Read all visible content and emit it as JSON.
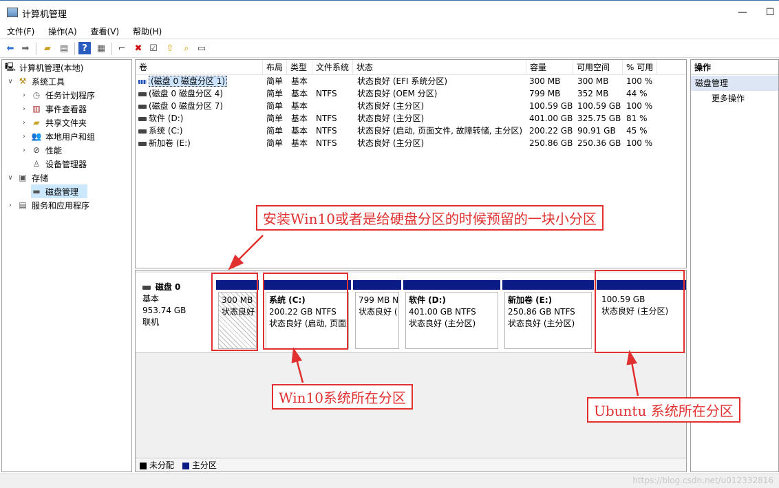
{
  "window": {
    "title": "计算机管理",
    "minimize": "—",
    "maximize": "☐"
  },
  "menu": [
    "文件(F)",
    "操作(A)",
    "查看(V)",
    "帮助(H)"
  ],
  "tree": {
    "root": "计算机管理(本地)",
    "system_tools": "系统工具",
    "task_scheduler": "任务计划程序",
    "event_viewer": "事件查看器",
    "shared_folders": "共享文件夹",
    "local_users": "本地用户和组",
    "performance": "性能",
    "device_manager": "设备管理器",
    "storage": "存储",
    "disk_management": "磁盘管理",
    "services": "服务和应用程序"
  },
  "volumes": {
    "headers": [
      "卷",
      "布局",
      "类型",
      "文件系统",
      "状态",
      "容量",
      "可用空间",
      "% 可用"
    ],
    "rows": [
      {
        "name": "(磁盘 0 磁盘分区 1)",
        "layout": "简单",
        "type": "基本",
        "fs": "",
        "status": "状态良好 (EFI 系统分区)",
        "capacity": "300 MB",
        "free": "300 MB",
        "pct": "100 %"
      },
      {
        "name": "(磁盘 0 磁盘分区 4)",
        "layout": "简单",
        "type": "基本",
        "fs": "NTFS",
        "status": "状态良好 (OEM 分区)",
        "capacity": "799 MB",
        "free": "352 MB",
        "pct": "44 %"
      },
      {
        "name": "(磁盘 0 磁盘分区 7)",
        "layout": "简单",
        "type": "基本",
        "fs": "",
        "status": "状态良好 (主分区)",
        "capacity": "100.59 GB",
        "free": "100.59 GB",
        "pct": "100 %"
      },
      {
        "name": "软件 (D:)",
        "layout": "简单",
        "type": "基本",
        "fs": "NTFS",
        "status": "状态良好 (主分区)",
        "capacity": "401.00 GB",
        "free": "325.75 GB",
        "pct": "81 %"
      },
      {
        "name": "系统 (C:)",
        "layout": "简单",
        "type": "基本",
        "fs": "NTFS",
        "status": "状态良好 (启动, 页面文件, 故障转储, 主分区)",
        "capacity": "200.22 GB",
        "free": "90.91 GB",
        "pct": "45 %"
      },
      {
        "name": "新加卷 (E:)",
        "layout": "简单",
        "type": "基本",
        "fs": "NTFS",
        "status": "状态良好 (主分区)",
        "capacity": "250.86 GB",
        "free": "250.36 GB",
        "pct": "100 %"
      }
    ]
  },
  "disk": {
    "name": "磁盘 0",
    "kind": "基本",
    "size": "953.74 GB",
    "state": "联机",
    "parts": [
      {
        "title": "",
        "size": "300 MB",
        "status": "状态良好"
      },
      {
        "title": "系统 (C:)",
        "size": "200.22 GB NTFS",
        "status": "状态良好 (启动, 页面文件"
      },
      {
        "title": "",
        "size": "799 MB N",
        "status": "状态良好 ("
      },
      {
        "title": "软件 (D:)",
        "size": "401.00 GB NTFS",
        "status": "状态良好 (主分区)"
      },
      {
        "title": "新加卷 (E:)",
        "size": "250.86 GB NTFS",
        "status": "状态良好 (主分区)"
      },
      {
        "title": "",
        "size": "100.59 GB",
        "status": "状态良好 (主分区)"
      }
    ]
  },
  "legend": {
    "unallocated": "未分配",
    "primary": "主分区"
  },
  "actions": {
    "header": "操作",
    "item": "磁盘管理",
    "more": "更多操作"
  },
  "annotations": {
    "reserved": "安装Win10或者是给硬盘分区的时候预留的一块小分区",
    "win10": "Win10系统所在分区",
    "ubuntu": "Ubuntu 系统所在分区"
  },
  "watermark": "https://blog.csdn.net/u012332816",
  "colors": {
    "primary_partition": "#0b1b86",
    "annotation_red": "#e03030",
    "selection": "#cce8ff"
  }
}
